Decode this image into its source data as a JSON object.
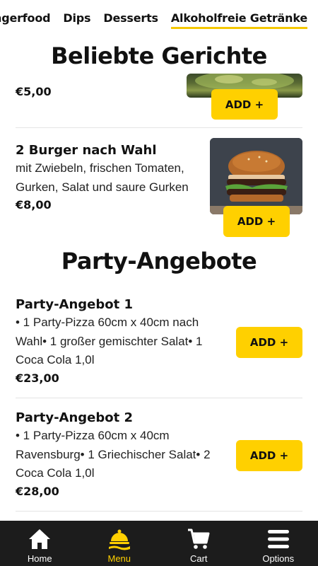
{
  "categories": [
    {
      "label": "Fingerfood",
      "active": false
    },
    {
      "label": "Dips",
      "active": false
    },
    {
      "label": "Desserts",
      "active": false
    },
    {
      "label": "Alkoholfreie Getränke",
      "active": true
    }
  ],
  "sections": {
    "popular": {
      "title": "Beliebte Gerichte"
    },
    "party": {
      "title": "Party-Angebote"
    }
  },
  "items": {
    "partial": {
      "price": "€5,00",
      "add_label": "ADD +"
    },
    "burger": {
      "name": "2 Burger nach Wahl",
      "description": "mit Zwiebeln, frischen Tomaten, Gurken, Salat und saure Gurken",
      "price": "€8,00",
      "add_label": "ADD +"
    },
    "party1": {
      "name": "Party-Angebot 1",
      "description": "• 1 Party-Pizza 60cm x 40cm nach Wahl• 1 großer gemischter Salat• 1 Coca Cola 1,0l",
      "price": "€23,00",
      "add_label": "ADD +"
    },
    "party2": {
      "name": "Party-Angebot 2",
      "description": "• 1 Party-Pizza 60cm x 40cm Ravensburg• 1 Griechischer Salat• 2 Coca Cola 1,0l",
      "price": "€28,00",
      "add_label": "ADD +"
    }
  },
  "nav": {
    "home": "Home",
    "menu": "Menu",
    "cart": "Cart",
    "options": "Options",
    "active": "menu"
  },
  "colors": {
    "accent": "#ffd000",
    "nav_bg": "#1c1c1c",
    "divider": "#e4e4e4"
  }
}
